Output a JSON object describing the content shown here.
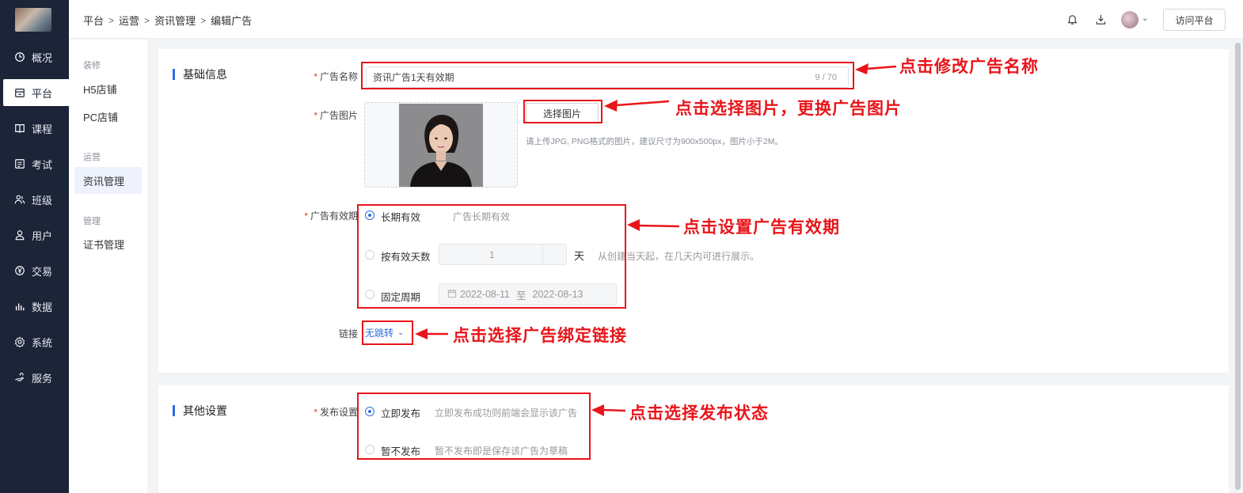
{
  "sidebar": {
    "items": [
      {
        "label": "概况",
        "icon": "clock-icon"
      },
      {
        "label": "平台",
        "icon": "store-icon"
      },
      {
        "label": "课程",
        "icon": "book-icon"
      },
      {
        "label": "考试",
        "icon": "exam-icon"
      },
      {
        "label": "班级",
        "icon": "group-icon"
      },
      {
        "label": "用户",
        "icon": "user-icon"
      },
      {
        "label": "交易",
        "icon": "yen-icon"
      },
      {
        "label": "数据",
        "icon": "bar-chart-icon"
      },
      {
        "label": "系统",
        "icon": "gear-icon"
      },
      {
        "label": "服务",
        "icon": "hand-icon"
      }
    ],
    "active": "平台"
  },
  "header": {
    "breadcrumb": [
      "平台",
      "运营",
      "资讯管理",
      "编辑广告"
    ],
    "visit_label": "访问平台"
  },
  "subnav": {
    "groups": [
      {
        "title": "装修",
        "items": [
          "H5店铺",
          "PC店铺"
        ]
      },
      {
        "title": "运营",
        "items": [
          "资讯管理"
        ]
      },
      {
        "title": "管理",
        "items": [
          "证书管理"
        ]
      }
    ],
    "active": "资讯管理"
  },
  "basic": {
    "title": "基础信息",
    "name_label": "广告名称",
    "name_value": "资讯广告1天有效期",
    "name_count": "9 / 70",
    "image_label": "广告图片",
    "choose_image": "选择图片",
    "image_hint": "请上传JPG, PNG格式的图片，建议尺寸为900x500px，图片小于2M。",
    "validity_label": "广告有效期",
    "options": {
      "long": {
        "label": "长期有效",
        "desc": "广告长期有效"
      },
      "days": {
        "label": "按有效天数",
        "value": "1",
        "unit": "天",
        "desc": "从创建当天起，在几天内可进行展示。"
      },
      "fixed": {
        "label": "固定周期",
        "start": "2022-08-11",
        "to": "至",
        "end": "2022-08-13"
      }
    },
    "validity_selected": "long",
    "link_label": "链接",
    "link_value": "无跳转"
  },
  "other": {
    "title": "其他设置",
    "publish_label": "发布设置",
    "publish_now": {
      "label": "立即发布",
      "desc": "立即发布成功则前端会显示该广告"
    },
    "publish_later": {
      "label": "暂不发布",
      "desc": "暂不发布即是保存该广告为草稿"
    },
    "publish_selected": "now"
  },
  "annotations": {
    "name": "点击修改广告名称",
    "image": "点击选择图片，更换广告图片",
    "validity": "点击设置广告有效期",
    "link": "点击选择广告绑定链接",
    "publish": "点击选择发布状态",
    "color": "#e8151a"
  }
}
